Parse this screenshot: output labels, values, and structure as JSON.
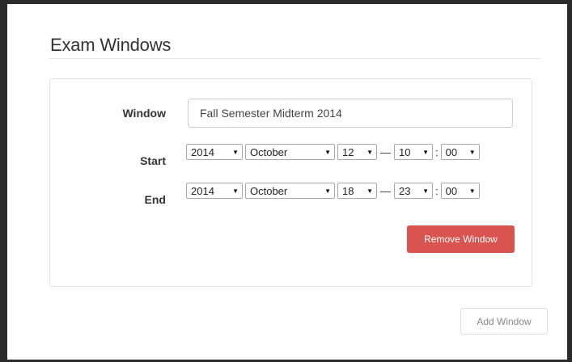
{
  "page": {
    "title": "Exam Windows"
  },
  "window_form": {
    "name_label": "Window",
    "name_value": "Fall Semester Midterm 2014",
    "start": {
      "label": "Start",
      "year": "2014",
      "month": "October",
      "day": "12",
      "dash": "—",
      "hour": "10",
      "colon": ":",
      "minute": "00"
    },
    "end": {
      "label": "End",
      "year": "2014",
      "month": "October",
      "day": "18",
      "dash": "—",
      "hour": "23",
      "colon": ":",
      "minute": "00"
    },
    "remove_button": "Remove Window"
  },
  "actions": {
    "add_button": "Add Window"
  },
  "icons": {
    "caret": "▼"
  },
  "colors": {
    "danger": "#d9534f"
  }
}
